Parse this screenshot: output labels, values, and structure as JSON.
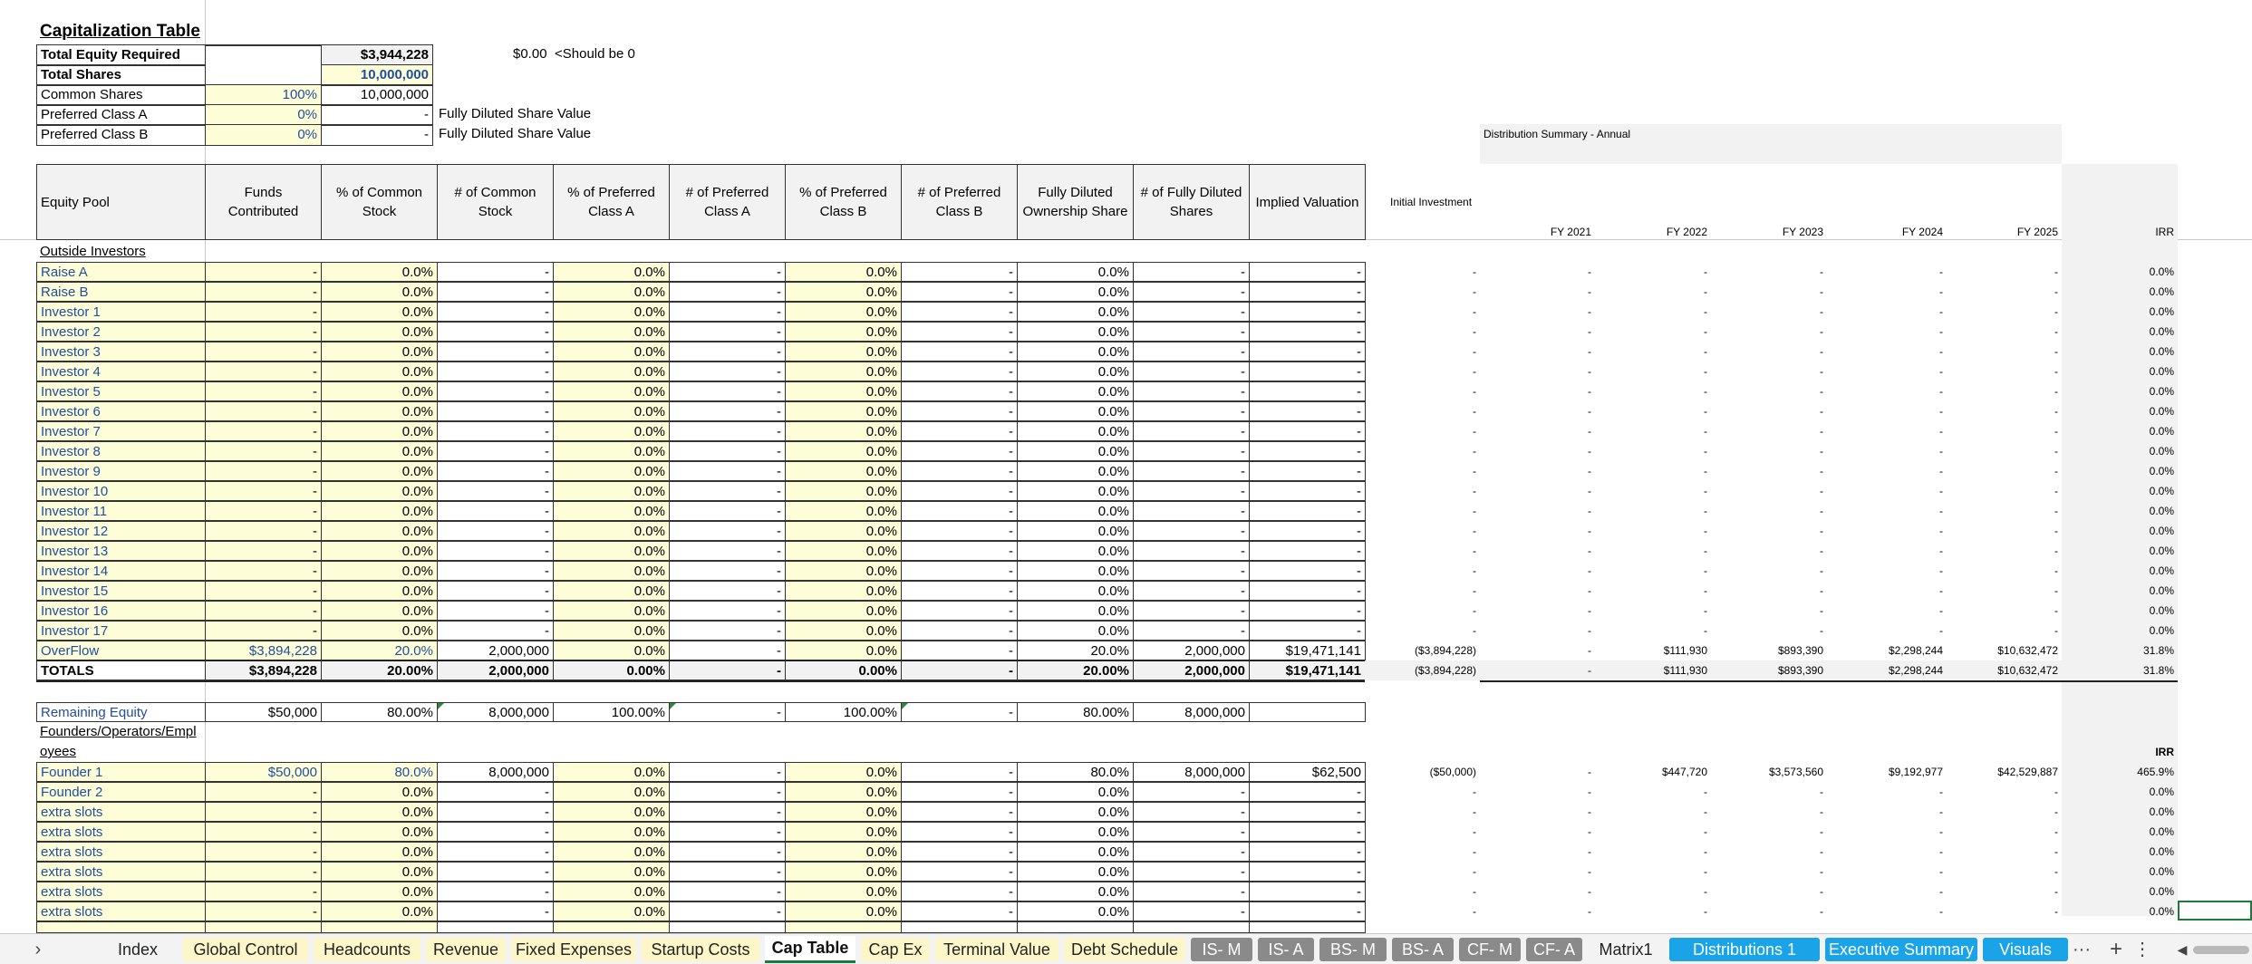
{
  "cap": {
    "title": "Capitalization Table",
    "total_equity_label": "Total Equity Required",
    "total_equity_value": "$3,944,228",
    "check_value": "$0.00",
    "check_note": "<Should be 0",
    "total_shares_label": "Total Shares",
    "total_shares_value": "10,000,000",
    "common_label": "Common Shares",
    "common_pct": "100%",
    "common_value": "10,000,000",
    "prefa_label": "Preferred Class A",
    "prefa_pct": "0%",
    "prefa_value": "-",
    "prefa_note": "Fully Diluted Share Value",
    "prefb_label": "Preferred Class B",
    "prefb_pct": "0%",
    "prefb_value": "-",
    "prefb_note": "Fully Diluted Share Value"
  },
  "columns": [
    "Equity Pool",
    "Funds Contributed",
    "% of Common Stock",
    "# of Common Stock",
    "% of Preferred Class A",
    "# of Preferred Class A",
    "% of Preferred Class B",
    "# of Preferred Class B",
    "Fully Diluted Ownership Share",
    "# of Fully Diluted Shares",
    "Implied Valuation"
  ],
  "dist": {
    "title": "Distribution Summary - Annual",
    "initial": "Initial Investment",
    "years": [
      "FY 2021",
      "FY 2022",
      "FY 2023",
      "FY 2024",
      "FY 2025"
    ],
    "irr": "IRR"
  },
  "outside_label": "Outside Investors",
  "investors": [
    {
      "name": "Raise A",
      "c": [
        "-",
        "0.0%",
        "-",
        "0.0%",
        "-",
        "0.0%",
        "-",
        "0.0%",
        "-",
        "-"
      ],
      "d": [
        "-",
        "-",
        "-",
        "-",
        "-",
        "-",
        "0.0%"
      ]
    },
    {
      "name": "Raise B",
      "c": [
        "-",
        "0.0%",
        "-",
        "0.0%",
        "-",
        "0.0%",
        "-",
        "0.0%",
        "-",
        "-"
      ],
      "d": [
        "-",
        "-",
        "-",
        "-",
        "-",
        "-",
        "0.0%"
      ]
    },
    {
      "name": "Investor 1",
      "c": [
        "-",
        "0.0%",
        "-",
        "0.0%",
        "-",
        "0.0%",
        "-",
        "0.0%",
        "-",
        "-"
      ],
      "d": [
        "-",
        "-",
        "-",
        "-",
        "-",
        "-",
        "0.0%"
      ]
    },
    {
      "name": "Investor 2",
      "c": [
        "-",
        "0.0%",
        "-",
        "0.0%",
        "-",
        "0.0%",
        "-",
        "0.0%",
        "-",
        "-"
      ],
      "d": [
        "-",
        "-",
        "-",
        "-",
        "-",
        "-",
        "0.0%"
      ]
    },
    {
      "name": "Investor 3",
      "c": [
        "-",
        "0.0%",
        "-",
        "0.0%",
        "-",
        "0.0%",
        "-",
        "0.0%",
        "-",
        "-"
      ],
      "d": [
        "-",
        "-",
        "-",
        "-",
        "-",
        "-",
        "0.0%"
      ]
    },
    {
      "name": "Investor 4",
      "c": [
        "-",
        "0.0%",
        "-",
        "0.0%",
        "-",
        "0.0%",
        "-",
        "0.0%",
        "-",
        "-"
      ],
      "d": [
        "-",
        "-",
        "-",
        "-",
        "-",
        "-",
        "0.0%"
      ]
    },
    {
      "name": "Investor 5",
      "c": [
        "-",
        "0.0%",
        "-",
        "0.0%",
        "-",
        "0.0%",
        "-",
        "0.0%",
        "-",
        "-"
      ],
      "d": [
        "-",
        "-",
        "-",
        "-",
        "-",
        "-",
        "0.0%"
      ]
    },
    {
      "name": "Investor 6",
      "c": [
        "-",
        "0.0%",
        "-",
        "0.0%",
        "-",
        "0.0%",
        "-",
        "0.0%",
        "-",
        "-"
      ],
      "d": [
        "-",
        "-",
        "-",
        "-",
        "-",
        "-",
        "0.0%"
      ]
    },
    {
      "name": "Investor 7",
      "c": [
        "-",
        "0.0%",
        "-",
        "0.0%",
        "-",
        "0.0%",
        "-",
        "0.0%",
        "-",
        "-"
      ],
      "d": [
        "-",
        "-",
        "-",
        "-",
        "-",
        "-",
        "0.0%"
      ]
    },
    {
      "name": "Investor 8",
      "c": [
        "-",
        "0.0%",
        "-",
        "0.0%",
        "-",
        "0.0%",
        "-",
        "0.0%",
        "-",
        "-"
      ],
      "d": [
        "-",
        "-",
        "-",
        "-",
        "-",
        "-",
        "0.0%"
      ]
    },
    {
      "name": "Investor 9",
      "c": [
        "-",
        "0.0%",
        "-",
        "0.0%",
        "-",
        "0.0%",
        "-",
        "0.0%",
        "-",
        "-"
      ],
      "d": [
        "-",
        "-",
        "-",
        "-",
        "-",
        "-",
        "0.0%"
      ]
    },
    {
      "name": "Investor 10",
      "c": [
        "-",
        "0.0%",
        "-",
        "0.0%",
        "-",
        "0.0%",
        "-",
        "0.0%",
        "-",
        "-"
      ],
      "d": [
        "-",
        "-",
        "-",
        "-",
        "-",
        "-",
        "0.0%"
      ]
    },
    {
      "name": "Investor 11",
      "c": [
        "-",
        "0.0%",
        "-",
        "0.0%",
        "-",
        "0.0%",
        "-",
        "0.0%",
        "-",
        "-"
      ],
      "d": [
        "-",
        "-",
        "-",
        "-",
        "-",
        "-",
        "0.0%"
      ]
    },
    {
      "name": "Investor 12",
      "c": [
        "-",
        "0.0%",
        "-",
        "0.0%",
        "-",
        "0.0%",
        "-",
        "0.0%",
        "-",
        "-"
      ],
      "d": [
        "-",
        "-",
        "-",
        "-",
        "-",
        "-",
        "0.0%"
      ]
    },
    {
      "name": "Investor 13",
      "c": [
        "-",
        "0.0%",
        "-",
        "0.0%",
        "-",
        "0.0%",
        "-",
        "0.0%",
        "-",
        "-"
      ],
      "d": [
        "-",
        "-",
        "-",
        "-",
        "-",
        "-",
        "0.0%"
      ]
    },
    {
      "name": "Investor 14",
      "c": [
        "-",
        "0.0%",
        "-",
        "0.0%",
        "-",
        "0.0%",
        "-",
        "0.0%",
        "-",
        "-"
      ],
      "d": [
        "-",
        "-",
        "-",
        "-",
        "-",
        "-",
        "0.0%"
      ]
    },
    {
      "name": "Investor 15",
      "c": [
        "-",
        "0.0%",
        "-",
        "0.0%",
        "-",
        "0.0%",
        "-",
        "0.0%",
        "-",
        "-"
      ],
      "d": [
        "-",
        "-",
        "-",
        "-",
        "-",
        "-",
        "0.0%"
      ]
    },
    {
      "name": "Investor 16",
      "c": [
        "-",
        "0.0%",
        "-",
        "0.0%",
        "-",
        "0.0%",
        "-",
        "0.0%",
        "-",
        "-"
      ],
      "d": [
        "-",
        "-",
        "-",
        "-",
        "-",
        "-",
        "0.0%"
      ]
    },
    {
      "name": "Investor 17",
      "c": [
        "-",
        "0.0%",
        "-",
        "0.0%",
        "-",
        "0.0%",
        "-",
        "0.0%",
        "-",
        "-"
      ],
      "d": [
        "-",
        "-",
        "-",
        "-",
        "-",
        "-",
        "0.0%"
      ]
    },
    {
      "name": "OverFlow",
      "c": [
        "$3,894,228",
        "20.0%",
        "2,000,000",
        "0.0%",
        "-",
        "0.0%",
        "-",
        "20.0%",
        "2,000,000",
        "$19,471,141"
      ],
      "d": [
        "($3,894,228)",
        "-",
        "$111,930",
        "$893,390",
        "$2,298,244",
        "$10,632,472",
        "31.8%"
      ]
    }
  ],
  "totals": {
    "name": "TOTALS",
    "c": [
      "$3,894,228",
      "20.00%",
      "2,000,000",
      "0.00%",
      "-",
      "0.00%",
      "-",
      "20.00%",
      "2,000,000",
      "$19,471,141"
    ],
    "d": [
      "($3,894,228)",
      "-",
      "$111,930",
      "$893,390",
      "$2,298,244",
      "$10,632,472",
      "31.8%"
    ]
  },
  "remaining": {
    "name": "Remaining Equity",
    "c": [
      "$50,000",
      "80.00%",
      "8,000,000",
      "100.00%",
      "-",
      "100.00%",
      "-",
      "80.00%",
      "8,000,000",
      ""
    ]
  },
  "founders_label": "Founders/Operators/Employees",
  "founders_irr": "IRR",
  "founders": [
    {
      "name": "Founder 1",
      "c": [
        "$50,000",
        "80.0%",
        "8,000,000",
        "0.0%",
        "-",
        "0.0%",
        "-",
        "80.0%",
        "8,000,000",
        "$62,500"
      ],
      "d": [
        "($50,000)",
        "-",
        "$447,720",
        "$3,573,560",
        "$9,192,977",
        "$42,529,887",
        "465.9%"
      ]
    },
    {
      "name": "Founder 2",
      "c": [
        "-",
        "0.0%",
        "-",
        "0.0%",
        "-",
        "0.0%",
        "-",
        "0.0%",
        "-",
        "-"
      ],
      "d": [
        "-",
        "-",
        "-",
        "-",
        "-",
        "-",
        "0.0%"
      ]
    },
    {
      "name": "extra slots",
      "c": [
        "-",
        "0.0%",
        "-",
        "0.0%",
        "-",
        "0.0%",
        "-",
        "0.0%",
        "-",
        "-"
      ],
      "d": [
        "-",
        "-",
        "-",
        "-",
        "-",
        "-",
        "0.0%"
      ]
    },
    {
      "name": "extra slots",
      "c": [
        "-",
        "0.0%",
        "-",
        "0.0%",
        "-",
        "0.0%",
        "-",
        "0.0%",
        "-",
        "-"
      ],
      "d": [
        "-",
        "-",
        "-",
        "-",
        "-",
        "-",
        "0.0%"
      ]
    },
    {
      "name": "extra slots",
      "c": [
        "-",
        "0.0%",
        "-",
        "0.0%",
        "-",
        "0.0%",
        "-",
        "0.0%",
        "-",
        "-"
      ],
      "d": [
        "-",
        "-",
        "-",
        "-",
        "-",
        "-",
        "0.0%"
      ]
    },
    {
      "name": "extra slots",
      "c": [
        "-",
        "0.0%",
        "-",
        "0.0%",
        "-",
        "0.0%",
        "-",
        "0.0%",
        "-",
        "-"
      ],
      "d": [
        "-",
        "-",
        "-",
        "-",
        "-",
        "-",
        "0.0%"
      ]
    },
    {
      "name": "extra slots",
      "c": [
        "-",
        "0.0%",
        "-",
        "0.0%",
        "-",
        "0.0%",
        "-",
        "0.0%",
        "-",
        "-"
      ],
      "d": [
        "-",
        "-",
        "-",
        "-",
        "-",
        "-",
        "0.0%"
      ]
    },
    {
      "name": "extra slots",
      "c": [
        "-",
        "0.0%",
        "-",
        "0.0%",
        "-",
        "0.0%",
        "-",
        "0.0%",
        "-",
        "-"
      ],
      "d": [
        "-",
        "-",
        "-",
        "-",
        "-",
        "-",
        "0.0%"
      ]
    }
  ],
  "tabs": [
    {
      "label": "Index",
      "style": "wh"
    },
    {
      "label": "Global Control",
      "style": "yl"
    },
    {
      "label": "Headcounts",
      "style": "yl"
    },
    {
      "label": "Revenue",
      "style": "yl"
    },
    {
      "label": "Fixed Expenses",
      "style": "yl"
    },
    {
      "label": "Startup Costs",
      "style": "yl"
    },
    {
      "label": "Cap Table",
      "style": "act"
    },
    {
      "label": "Cap Ex",
      "style": "yl"
    },
    {
      "label": "Terminal Value",
      "style": "yl"
    },
    {
      "label": "Debt Schedule",
      "style": "yl"
    },
    {
      "label": "IS- M",
      "style": "gy"
    },
    {
      "label": "IS- A",
      "style": "gy"
    },
    {
      "label": "BS- M",
      "style": "gy"
    },
    {
      "label": "BS- A",
      "style": "gy"
    },
    {
      "label": "CF- M",
      "style": "gy"
    },
    {
      "label": "CF- A",
      "style": "gy"
    },
    {
      "label": "Matrix1",
      "style": "wh"
    },
    {
      "label": "Distributions 1",
      "style": "bl"
    },
    {
      "label": "Executive Summary",
      "style": "bl"
    },
    {
      "label": "Visuals",
      "style": "bl"
    }
  ],
  "tabbar_icons": {
    "nav": "chevron-right-icon",
    "more": "ellipsis-icon",
    "add": "plus-icon",
    "options": "vertical-ellipsis-icon",
    "scroll": "scroll-left-icon"
  },
  "tabbar_glyphs": {
    "nav": "›",
    "more": "···",
    "add": "+",
    "options": "⋮",
    "scroll": "◀"
  }
}
